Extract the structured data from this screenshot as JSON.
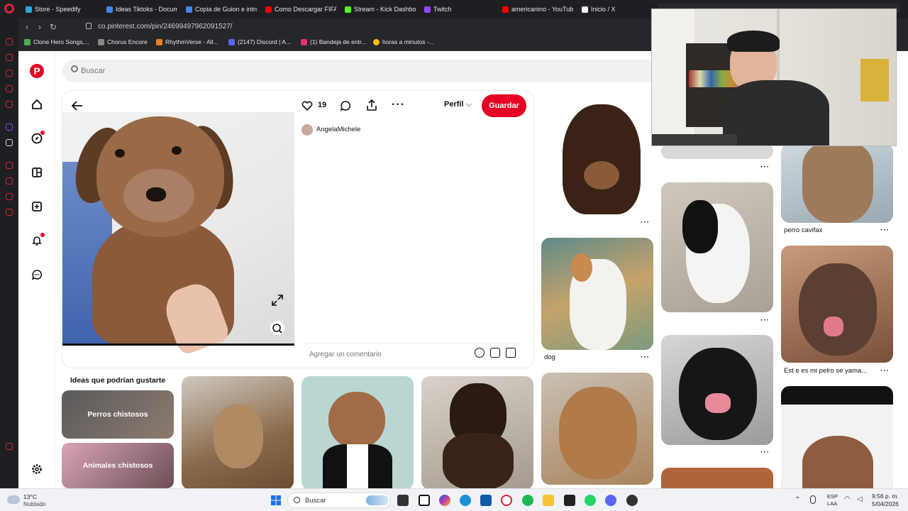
{
  "browser": {
    "tabs": [
      {
        "label": "Store - Speedify",
        "color": "#2aa8e0"
      },
      {
        "label": "Ideas Tiktoks - Docum",
        "color": "#4285f4"
      },
      {
        "label": "Copia de Guion e intro",
        "color": "#4285f4"
      },
      {
        "label": "Como Descargar FIFA",
        "color": "#ff0000"
      },
      {
        "label": "Stream - Kick Dashbo",
        "color": "#53fc18"
      },
      {
        "label": "Twitch",
        "color": "#9146ff"
      },
      {
        "label": "americanino - YouTub",
        "color": "#ff0000"
      },
      {
        "label": "Inicio / X",
        "color": "#ffffff"
      }
    ],
    "url": "co.pinterest.com/pin/24699497962091527/",
    "bookmarks": [
      {
        "label": "Clone Hero Songs,...",
        "color": "#4caf50"
      },
      {
        "label": "Chorus Encore",
        "color": "#888888"
      },
      {
        "label": "RhythmVerse - All...",
        "color": "#e67e22"
      },
      {
        "label": "(2147) Discord | A...",
        "color": "#5865f2"
      },
      {
        "label": "(1) Bandeja de entr...",
        "color": "#e1306c"
      },
      {
        "label": "horas a minutos -...",
        "color": "#fbbc05"
      }
    ]
  },
  "pinterest": {
    "search_placeholder": "Buscar",
    "pin": {
      "like_count": "19",
      "profile_label": "Perfil",
      "save_label": "Guardar",
      "author": "AngelaMichele",
      "comment_placeholder": "Agregar un comentario"
    },
    "ideas": {
      "title": "Ideas que podrían gustarte",
      "chips": [
        "Perros chistosos",
        "Animales chistosos"
      ]
    },
    "feed": {
      "labels": [
        "dog",
        "perro cavifax",
        "Est e es mi pelro se yama..."
      ]
    }
  },
  "taskbar": {
    "weather_temp": "13°C",
    "weather_desc": "Nublado",
    "search_label": "Buscar",
    "lang_line1": "ESP",
    "lang_line2": "LAA",
    "time": "9:56 p. m.",
    "date": "5/04/2026"
  }
}
